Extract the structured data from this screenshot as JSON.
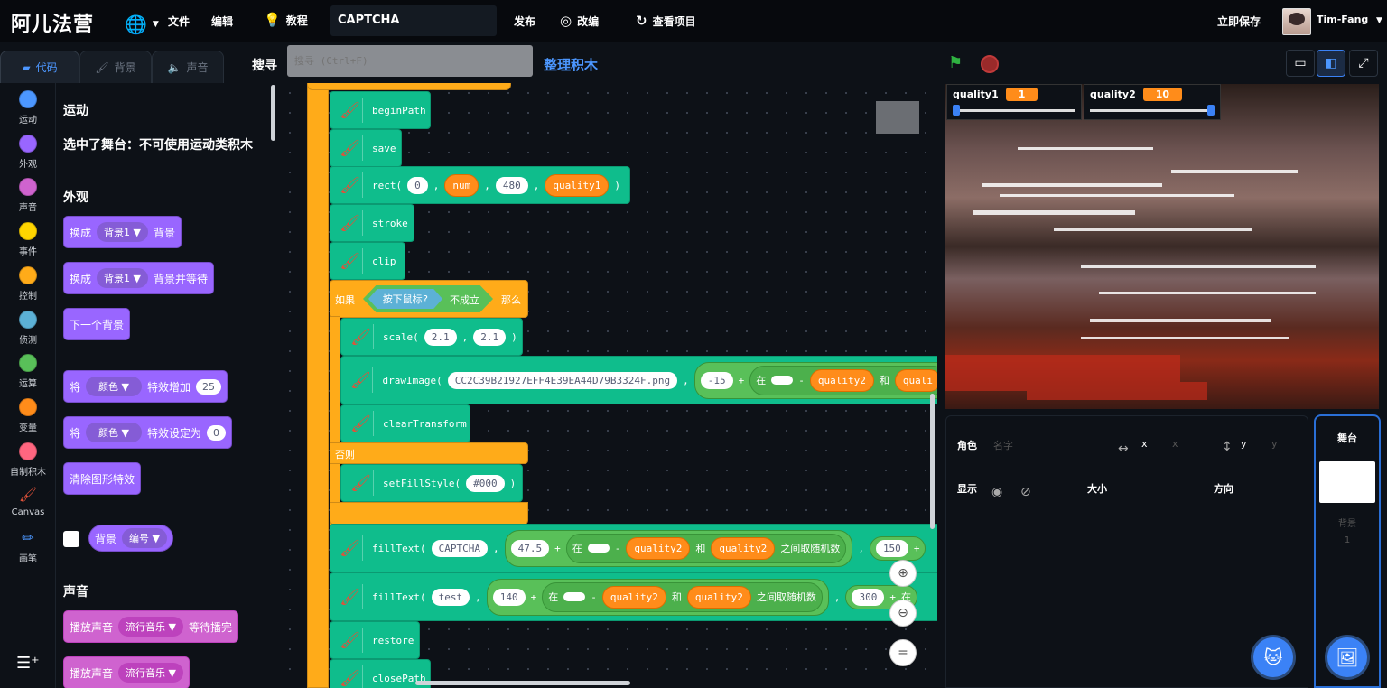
{
  "menubar": {
    "logo": "阿儿法营",
    "file": "文件",
    "edit": "编辑",
    "tutorial": "教程",
    "project_title": "CAPTCHA",
    "publish": "发布",
    "remix": "改编",
    "see_project": "查看项目",
    "save_now": "立即保存",
    "username": "Tim-Fang"
  },
  "tabs": {
    "code": "代码",
    "costumes": "背景",
    "sounds": "声音"
  },
  "toolbar": {
    "search_label": "搜寻",
    "search_placeholder": "搜寻 (Ctrl+F)",
    "tidy": "整理积木"
  },
  "categories": [
    {
      "label": "运动",
      "color": "#4c97ff"
    },
    {
      "label": "外观",
      "color": "#9966ff"
    },
    {
      "label": "声音",
      "color": "#cf63cf"
    },
    {
      "label": "事件",
      "color": "#ffd500"
    },
    {
      "label": "控制",
      "color": "#ffab19"
    },
    {
      "label": "侦测",
      "color": "#5cb1d6"
    },
    {
      "label": "运算",
      "color": "#59c059"
    },
    {
      "label": "变量",
      "color": "#ff8c1a"
    },
    {
      "label": "自制积木",
      "color": "#ff6680"
    },
    {
      "label": "Canvas",
      "color": "brush"
    },
    {
      "label": "画笔",
      "color": "pen"
    }
  ],
  "palette": {
    "motion_title": "运动",
    "motion_note": "选中了舞台：不可使用运动类积木",
    "looks_title": "外观",
    "switch_backdrop": "换成",
    "backdrop1": "背景1",
    "backdrop_word": "背景",
    "backdrop_wait": "背景并等待",
    "next_backdrop": "下一个背景",
    "set_word": "将",
    "color": "颜色",
    "change_effect": "特效增加",
    "change_val": "25",
    "set_effect": "特效设定为",
    "set_val": "0",
    "clear_effects": "清除图形特效",
    "backdrop_reporter": "背景",
    "number": "编号",
    "sound_title": "声音",
    "play_sound": "播放声音",
    "pop_music": "流行音乐",
    "until_done": "等待播完"
  },
  "script": {
    "beginPath": "beginPath",
    "save": "save",
    "rect": "rect(",
    "rect_a": "0",
    "rect_b": "num",
    "rect_c": "480",
    "rect_d": "quality1",
    "close_paren": ")",
    "comma": ",",
    "stroke": "stroke",
    "clip": "clip",
    "if": "如果",
    "mouse_down": "按下鼠标?",
    "not": "不成立",
    "then": "那么",
    "scale": "scale(",
    "scale_x": "2.1",
    "scale_y": "2.1",
    "drawImage": "drawImage(",
    "image_name": "CC2C39B21927EFF4E39EA44D79B3324F.png",
    "neg15": "-15",
    "plus": "+",
    "in": "在",
    "minus": "-",
    "quality2": "quality2",
    "and": "和",
    "quality_trunc": "quali",
    "clearTransform": "clearTransform",
    "else": "否则",
    "setFillStyle": "setFillStyle(",
    "fill_color": "#000",
    "fillText": "fillText(",
    "text1": "CAPTCHA",
    "x1": "47.5",
    "random": "之间取随机数",
    "y1": "150",
    "text2": "test",
    "x2": "140",
    "y2": "300",
    "restore": "restore",
    "closePath": "closePath"
  },
  "monitors": [
    {
      "name": "quality1",
      "value": "1",
      "level": 0.0
    },
    {
      "name": "quality2",
      "value": "10",
      "level": 1.0
    }
  ],
  "sprite_info": {
    "sprite": "角色",
    "name_placeholder": "名字",
    "x": "x",
    "y": "y",
    "show": "显示",
    "size": "大小",
    "direction": "方向"
  },
  "stage_panel": {
    "title": "舞台",
    "backdrops": "背景",
    "count": "1"
  }
}
